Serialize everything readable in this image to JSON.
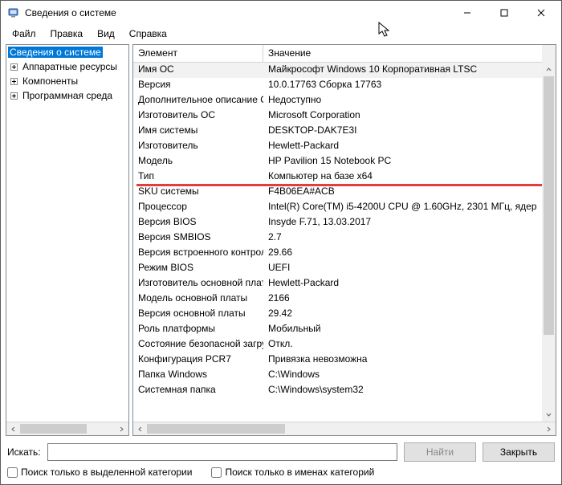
{
  "window": {
    "title": "Сведения о системе"
  },
  "menu": {
    "file": "Файл",
    "edit": "Правка",
    "view": "Вид",
    "help": "Справка"
  },
  "tree": {
    "root": "Сведения о системе",
    "items": [
      "Аппаратные ресурсы",
      "Компоненты",
      "Программная среда"
    ]
  },
  "list": {
    "header0": "Элемент",
    "header1": "Значение",
    "rows": [
      {
        "e": "Имя ОС",
        "v": "Майкрософт Windows 10 Корпоративная LTSC"
      },
      {
        "e": "Версия",
        "v": "10.0.17763 Сборка 17763"
      },
      {
        "e": "Дополнительное описание ОС",
        "v": "Недоступно"
      },
      {
        "e": "Изготовитель ОС",
        "v": "Microsoft Corporation"
      },
      {
        "e": "Имя системы",
        "v": "DESKTOP-DAK7E3I"
      },
      {
        "e": "Изготовитель",
        "v": "Hewlett-Packard"
      },
      {
        "e": "Модель",
        "v": "HP Pavilion 15 Notebook PC"
      },
      {
        "e": "Тип",
        "v": "Компьютер на базе x64"
      },
      {
        "e": "SKU системы",
        "v": "F4B06EA#ACB"
      },
      {
        "e": "Процессор",
        "v": "Intel(R) Core(TM) i5-4200U CPU @ 1.60GHz, 2301 МГц, ядер"
      },
      {
        "e": "Версия BIOS",
        "v": "Insyde F.71, 13.03.2017"
      },
      {
        "e": "Версия SMBIOS",
        "v": "2.7"
      },
      {
        "e": "Версия встроенного контроллера",
        "v": "29.66"
      },
      {
        "e": "Режим BIOS",
        "v": "UEFI"
      },
      {
        "e": "Изготовитель основной платы",
        "v": "Hewlett-Packard"
      },
      {
        "e": "Модель основной платы",
        "v": "2166"
      },
      {
        "e": "Версия основной платы",
        "v": "29.42"
      },
      {
        "e": "Роль платформы",
        "v": "Мобильный"
      },
      {
        "e": "Состояние безопасной загрузки",
        "v": "Откл."
      },
      {
        "e": "Конфигурация PCR7",
        "v": "Привязка невозможна"
      },
      {
        "e": "Папка Windows",
        "v": "C:\\Windows"
      },
      {
        "e": "Системная папка",
        "v": "C:\\Windows\\system32"
      }
    ]
  },
  "search": {
    "label": "Искать:",
    "find": "Найти",
    "close": "Закрыть",
    "chk1": "Поиск только в выделенной категории",
    "chk2": "Поиск только в именах категорий"
  }
}
